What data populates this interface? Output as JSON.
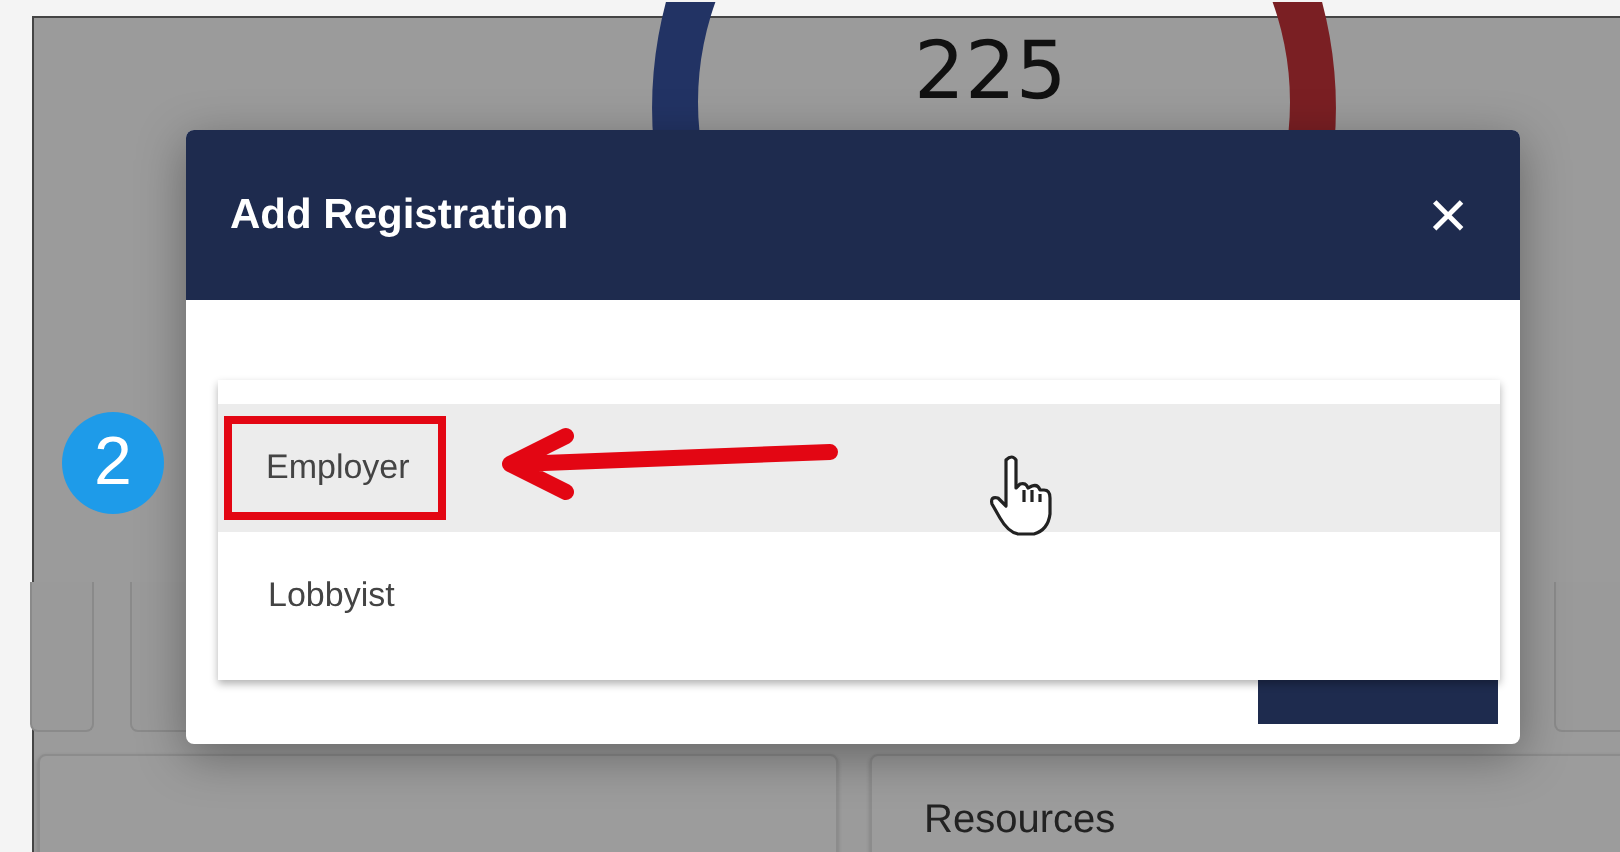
{
  "dashboard": {
    "total": "225",
    "cards": [
      {
        "title": "Resources"
      }
    ]
  },
  "dialog": {
    "title": "Add Registration",
    "close": "×",
    "menu": [
      {
        "label": "Employer",
        "selected": true,
        "highlighted": true
      },
      {
        "label": "Lobbyist",
        "selected": false,
        "highlighted": false
      }
    ]
  },
  "callout": {
    "step": "2"
  }
}
